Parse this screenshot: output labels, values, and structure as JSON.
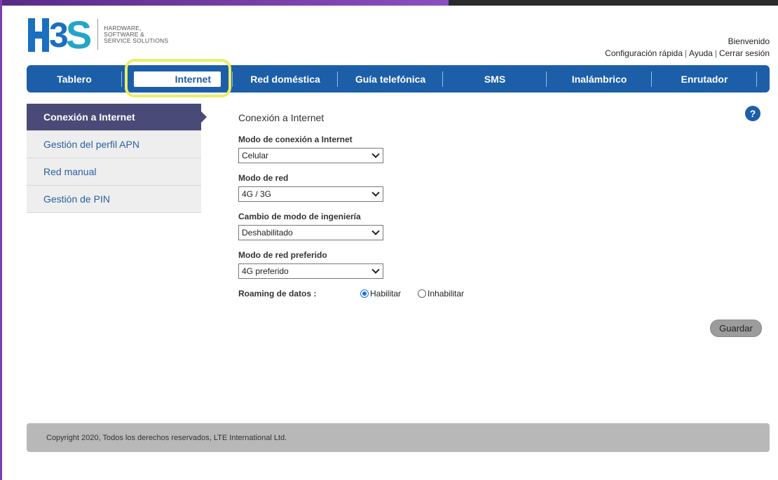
{
  "brand": {
    "logo_letters": [
      "3",
      "S"
    ],
    "logo_text_lines": [
      "HARDWARE,",
      "SOFTWARE &",
      "SERVICE SOLUTIONS"
    ],
    "colors": {
      "primary": "#1c5ea8",
      "logo_blue": "#1a6fc0",
      "logo_cyan": "#21a6c8",
      "sidebar_active": "#4a4a78",
      "highlight": "#e9ee6a"
    }
  },
  "header": {
    "welcome": "Bienvenido",
    "links": [
      "Configuración rápida",
      "Ayuda",
      "Cerrar sesión"
    ],
    "separator": "|"
  },
  "nav": {
    "items": [
      "Tablero",
      "Internet",
      "Red doméstica",
      "Guía telefónica",
      "SMS",
      "Inalámbrico",
      "Enrutador"
    ],
    "active": "Internet"
  },
  "sidebar": {
    "items": [
      "Conexión a Internet",
      "Gestión del perfil APN",
      "Red manual",
      "Gestión de PIN"
    ],
    "active": "Conexión a Internet"
  },
  "main": {
    "title": "Conexión a Internet",
    "fields": [
      {
        "label": "Modo de conexión a Internet",
        "value": "Celular"
      },
      {
        "label": "Modo de red",
        "value": "4G / 3G"
      },
      {
        "label": "Cambio de modo de ingeniería",
        "value": "Deshabilitado"
      },
      {
        "label": "Modo de red preferido",
        "value": "4G preferido"
      }
    ],
    "roaming": {
      "label": "Roaming de datos :",
      "options": [
        "Habilitar",
        "Inhabilitar"
      ],
      "selected": "Habilitar"
    },
    "save_label": "Guardar",
    "help_glyph": "?"
  },
  "footer": {
    "copyright": "Copyright 2020, Todos los derechos reservados, LTE International Ltd."
  },
  "icons": [
    "help-icon",
    "chevron-down-icon",
    "radio-icon"
  ]
}
